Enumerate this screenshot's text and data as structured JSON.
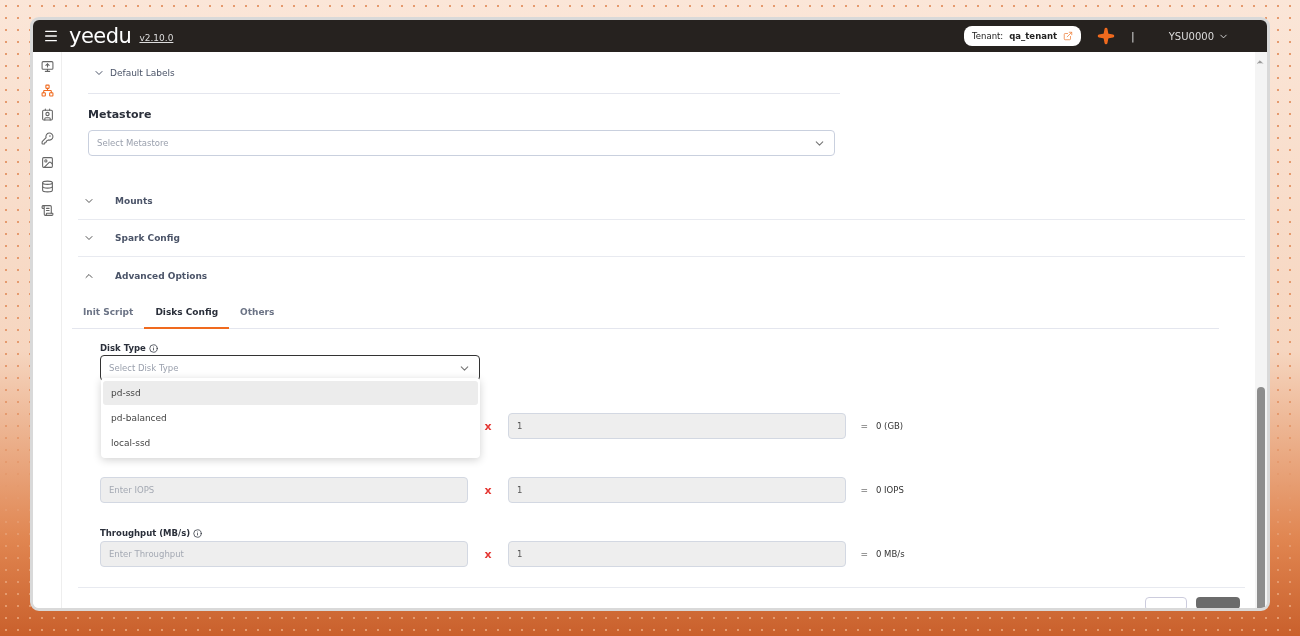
{
  "header": {
    "logo": "yeedu",
    "version": "v2.10.0",
    "tenant_label": "Tenant:",
    "tenant": "qa_tenant",
    "separator": "|",
    "user": "YSU0000"
  },
  "sidebar": {
    "items": [
      {
        "selected": false
      },
      {
        "selected": true
      },
      {
        "selected": false
      },
      {
        "selected": false
      },
      {
        "selected": false
      },
      {
        "selected": false
      },
      {
        "selected": false
      }
    ]
  },
  "default_labels": {
    "label": "Default Labels",
    "expanded": false
  },
  "metastore": {
    "label": "Metastore",
    "placeholder": "Select Metastore"
  },
  "accordions": [
    {
      "title": "Mounts",
      "expanded": false
    },
    {
      "title": "Spark Config",
      "expanded": false
    },
    {
      "title": "Advanced Options",
      "expanded": true
    }
  ],
  "tabs": [
    {
      "label": "Init Script",
      "selected": false
    },
    {
      "label": "Disks Config",
      "selected": true
    },
    {
      "label": "Others",
      "selected": false
    }
  ],
  "disk_type": {
    "label": "Disk Type",
    "placeholder": "Select Disk Type",
    "options": [
      {
        "label": "pd-ssd",
        "selected": true
      },
      {
        "label": "pd-balanced",
        "selected": false
      },
      {
        "label": "local-ssd",
        "selected": false
      }
    ]
  },
  "rows": [
    {
      "multiplier": "x",
      "count": "1",
      "equals": "=",
      "result": "0 (GB)"
    },
    {
      "placeholder": "Enter IOPS",
      "multiplier": "x",
      "count": "1",
      "equals": "=",
      "result": "0 IOPS"
    },
    {
      "label": "Throughput (MB/s)",
      "placeholder": "Enter Throughput",
      "multiplier": "x",
      "count": "1",
      "equals": "=",
      "result": "0 MB/s"
    }
  ]
}
